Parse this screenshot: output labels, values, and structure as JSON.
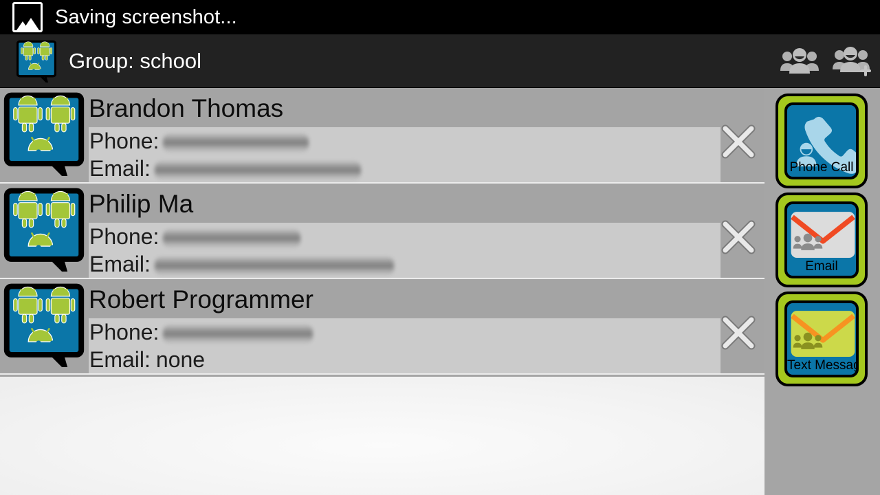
{
  "status_bar": {
    "icon": "screenshot-image-icon",
    "text": "Saving screenshot..."
  },
  "action_bar": {
    "app_icon": "group-contacts-icon",
    "title": "Group: school",
    "buttons": [
      {
        "name": "view-group-button",
        "icon": "group-icon",
        "label": "Group"
      },
      {
        "name": "add-group-button",
        "icon": "group-add-icon",
        "label": "Add Group"
      }
    ]
  },
  "contacts": [
    {
      "avatar": "group-contacts-icon",
      "name": "Brandon Thomas",
      "phone_label": "Phone:",
      "phone_value": "",
      "phone_redacted": true,
      "phone_redact_width": 212,
      "email_label": "Email:",
      "email_value": "",
      "email_redacted": true,
      "email_redact_width": 300,
      "delete_icon": "close-x-icon"
    },
    {
      "avatar": "group-contacts-icon",
      "name": "Philip Ma",
      "phone_label": "Phone:",
      "phone_value": "",
      "phone_redacted": true,
      "phone_redact_width": 200,
      "email_label": "Email:",
      "email_value": "",
      "email_redacted": true,
      "email_redact_width": 348,
      "delete_icon": "close-x-icon"
    },
    {
      "avatar": "group-contacts-icon",
      "name": "Robert Programmer",
      "phone_label": "Phone:",
      "phone_value": "",
      "phone_redacted": true,
      "phone_redact_width": 218,
      "email_label": "Email:",
      "email_value": "none",
      "email_redacted": false,
      "email_redact_width": 0,
      "delete_icon": "close-x-icon"
    }
  ],
  "action_column": [
    {
      "name": "phone-call-button",
      "label": "Phone Call",
      "icon": "phone-handset-person-icon"
    },
    {
      "name": "email-button",
      "label": "Email",
      "icon": "envelope-group-icon"
    },
    {
      "name": "text-message-button",
      "label": "Text Message",
      "icon": "envelope-group-icon"
    }
  ],
  "colors": {
    "status_bar_bg": "#000000",
    "action_bar_bg": "#222222",
    "list_row_bg": "#a4a4a4",
    "detail_bg": "#cbcbcb",
    "panel_bg": "#f4f4f4",
    "button_green": "#a4c81e",
    "button_blue": "#0b76a8",
    "android_green": "#a4c639",
    "envelope_red": "#f04a23",
    "envelope_orange": "#f79321",
    "text_envelope_fill": "#ccd94a"
  }
}
